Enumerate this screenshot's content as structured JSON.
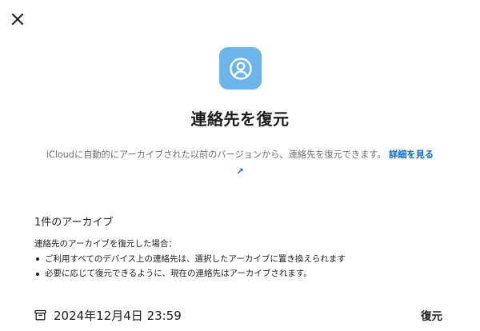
{
  "dialog": {
    "title": "連絡先を復元",
    "description_text": "iCloudに自動的にアーカイブされた以前のバージョンから、連絡先を復元できます。",
    "learn_more_link": "詳細を見る",
    "learn_more_arrow": "↗"
  },
  "archives": {
    "heading": "1件のアーカイブ",
    "note_intro": "連絡先のアーカイブを復元した場合：",
    "note_items": [
      "ご利用すべてのデバイス上の連絡先は、選択したアーカイブに置き換えられます",
      "必要に応じて復元できるように、現在の連絡先はアーカイブされます。"
    ],
    "rows": [
      {
        "date": "2024年12月4日 23:59",
        "action_label": "復元"
      }
    ]
  },
  "icons": {
    "close": "close-icon",
    "app": "contacts-person-icon",
    "archive_box": "archive-box-icon"
  },
  "colors": {
    "app_icon_bg": "#6bb4ec",
    "link": "#0a66d8"
  }
}
